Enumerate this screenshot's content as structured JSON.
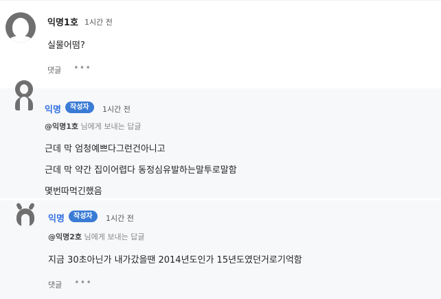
{
  "comments": [
    {
      "author": "익명1호",
      "time": "1시간 전",
      "lines": [
        "실물어떰?"
      ],
      "reply_label": "댓글",
      "more_label": "•••"
    },
    {
      "author": "익명",
      "badge": "작성자",
      "time": "1시간 전",
      "mention_target": "@익명1호",
      "mention_suffix": " 님에게 보내는 답글",
      "lines": [
        "근데 막 엄청예쁘다그런건아니고",
        "근데 막 약간 집이어렵다 동정심유발하는말투로말함",
        "몇번따먹긴했음"
      ]
    },
    {
      "author": "익명",
      "badge": "작성자",
      "time": "1시간 전",
      "mention_target": "@익명2호",
      "mention_suffix": " 님에게 보내는 답글",
      "lines": [
        "지금 30초아닌가 내가갔을땐 2014년도인가 15년도였던거로기억함"
      ],
      "reply_label": "댓글",
      "more_label": "•••"
    }
  ]
}
